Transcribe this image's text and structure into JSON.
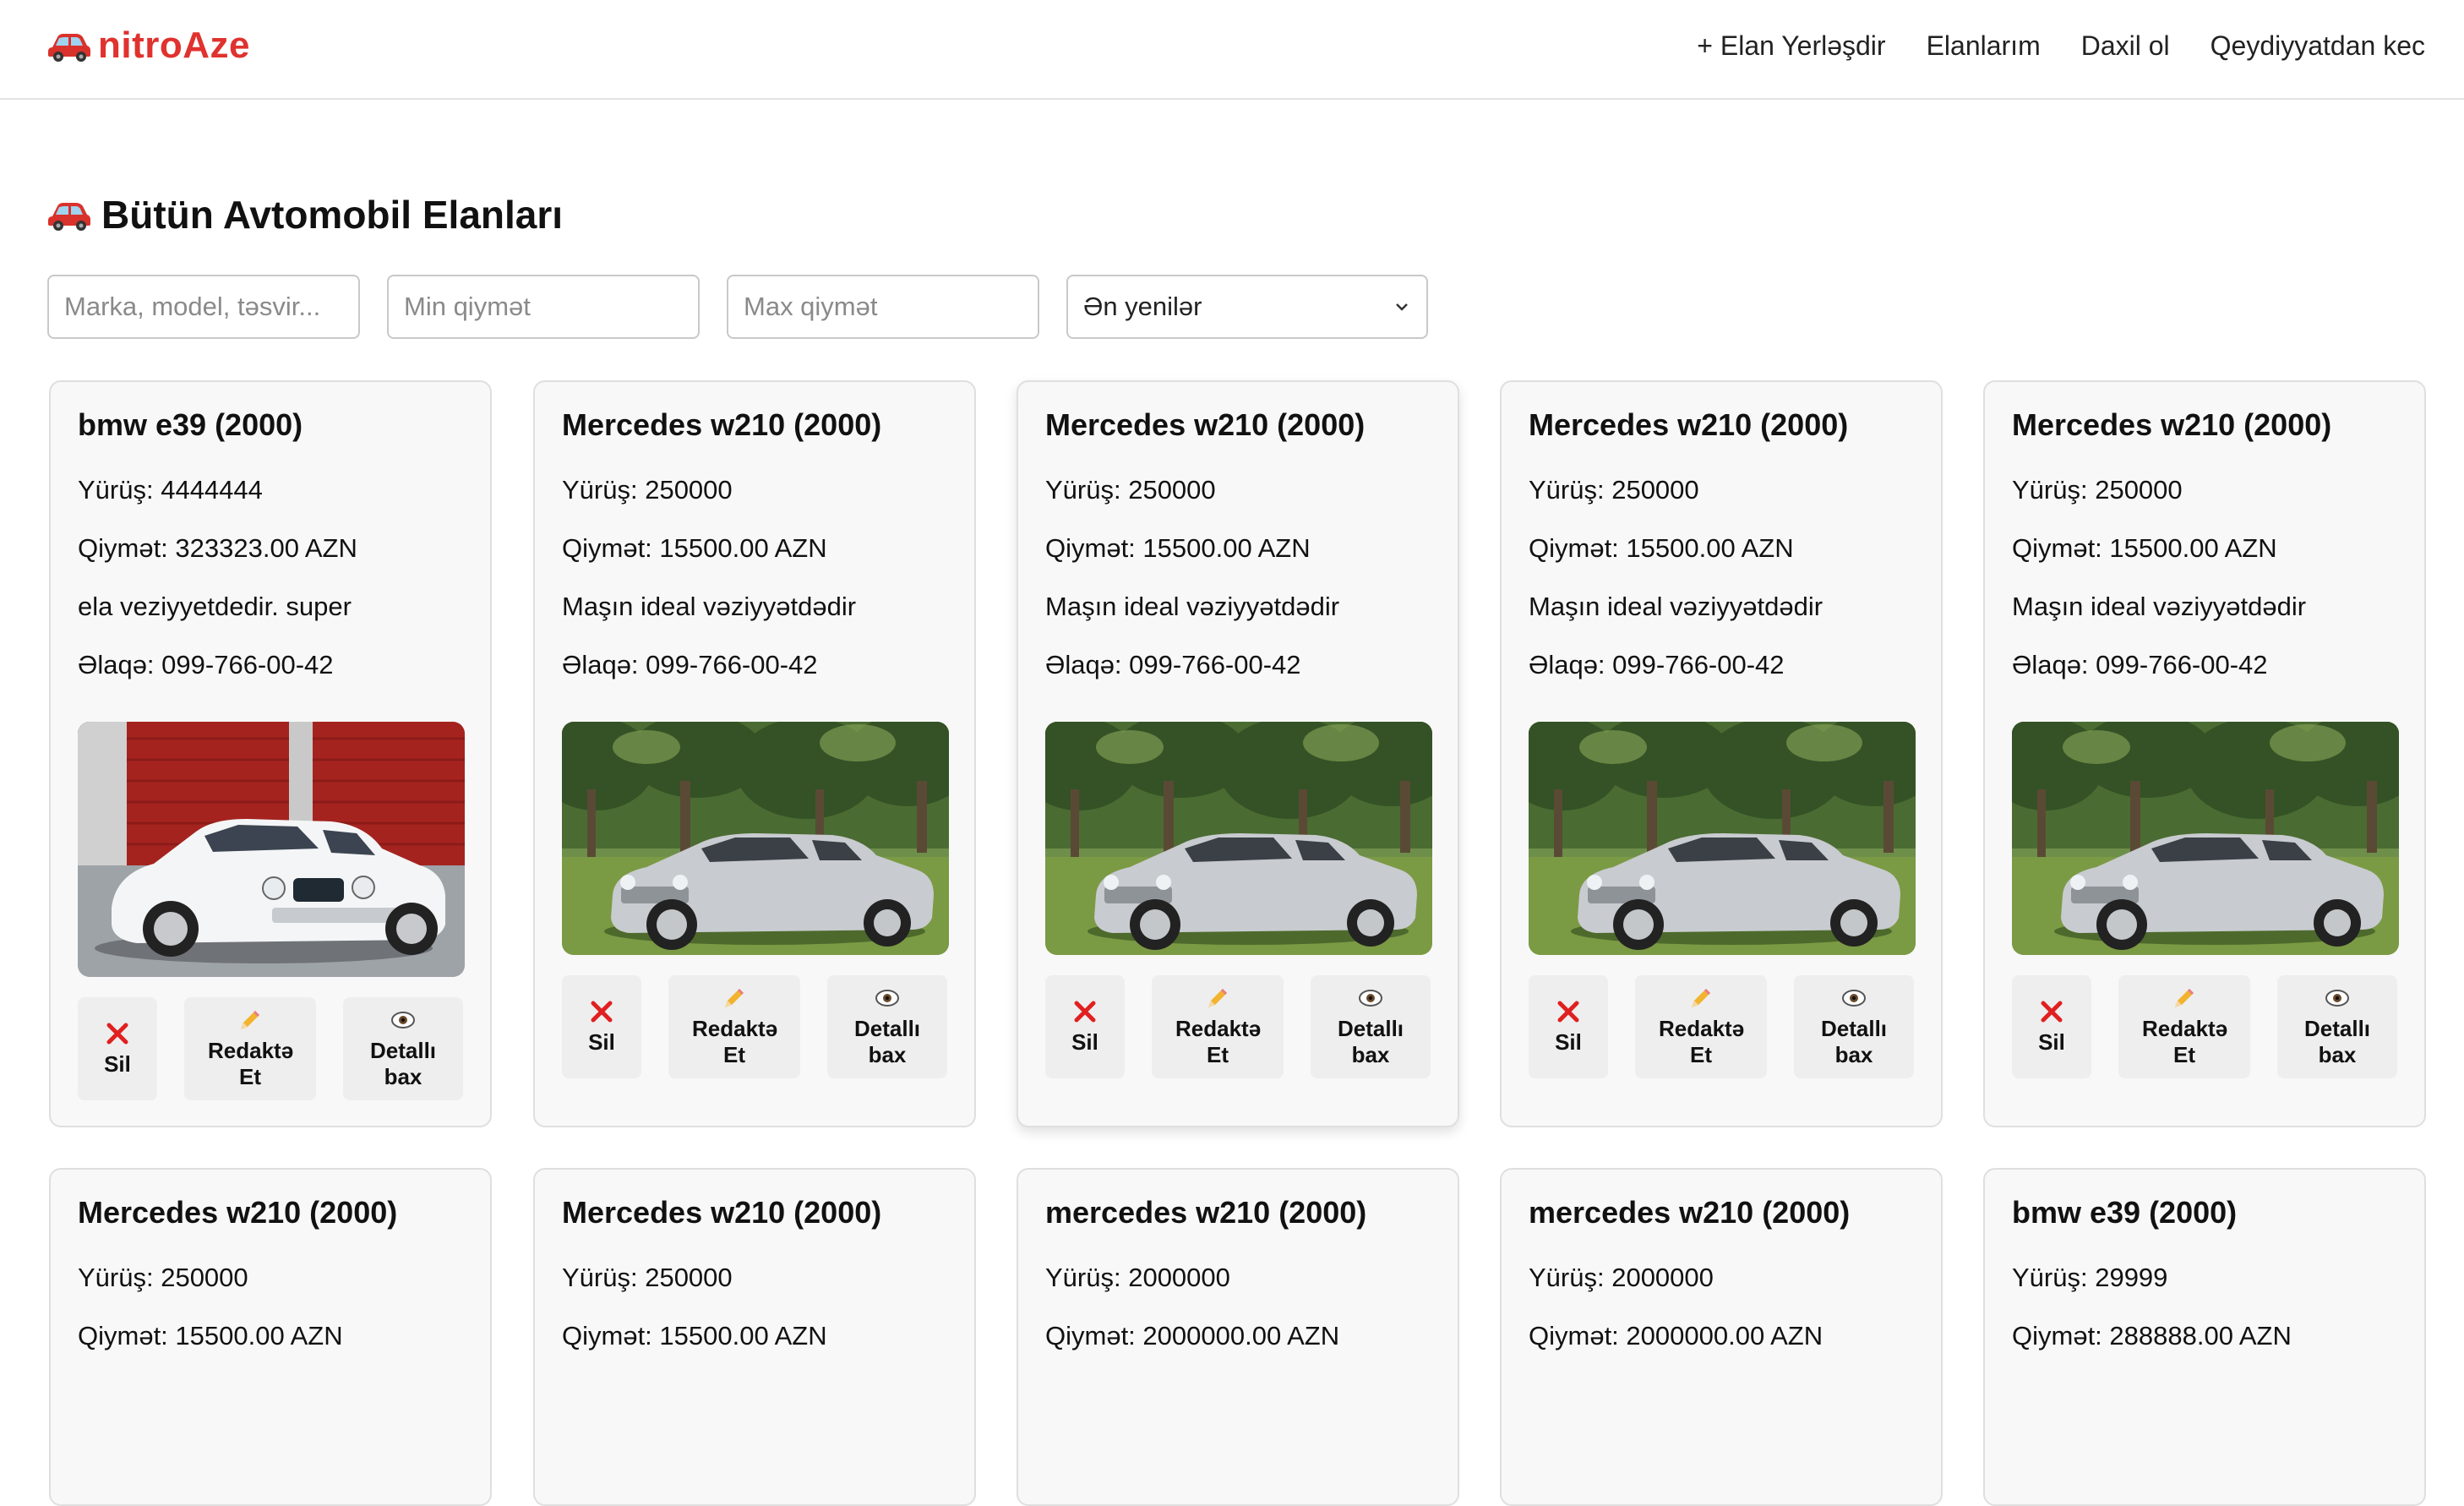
{
  "header": {
    "logo": "nitroAze",
    "nav": [
      "+ Elan Yerləşdir",
      "Elanlarım",
      "Daxil ol",
      "Qeydiyyatdan kec"
    ]
  },
  "page_title": "Bütün Avtomobil Elanları",
  "filters": {
    "search_placeholder": "Marka, model, təsvir...",
    "min_placeholder": "Min qiymət",
    "max_placeholder": "Max qiymət",
    "sort_selected": "Ən yenilər"
  },
  "actions": {
    "delete": "Sil",
    "edit": "Redaktə Et",
    "details": "Detallı bax"
  },
  "cards": [
    {
      "title": "bmw e39 (2000)",
      "mileage": "Yürüş: 4444444",
      "price": "Qiymət: 323323.00 AZN",
      "desc": "ela veziyyetdedir. super",
      "contact": "Əlaqə: 099-766-00-42",
      "image": "white-bmw"
    },
    {
      "title": "Mercedes w210 (2000)",
      "mileage": "Yürüş: 250000",
      "price": "Qiymət: 15500.00 AZN",
      "desc": "Maşın ideal vəziyyətdədir",
      "contact": "Əlaqə: 099-766-00-42",
      "image": "silver-mercedes"
    },
    {
      "title": "Mercedes w210 (2000)",
      "mileage": "Yürüş: 250000",
      "price": "Qiymət: 15500.00 AZN",
      "desc": "Maşın ideal vəziyyətdədir",
      "contact": "Əlaqə: 099-766-00-42",
      "image": "silver-mercedes"
    },
    {
      "title": "Mercedes w210 (2000)",
      "mileage": "Yürüş: 250000",
      "price": "Qiymət: 15500.00 AZN",
      "desc": "Maşın ideal vəziyyətdədir",
      "contact": "Əlaqə: 099-766-00-42",
      "image": "silver-mercedes"
    },
    {
      "title": "Mercedes w210 (2000)",
      "mileage": "Yürüş: 250000",
      "price": "Qiymət: 15500.00 AZN",
      "desc": "Maşın ideal vəziyyətdədir",
      "contact": "Əlaqə: 099-766-00-42",
      "image": "silver-mercedes"
    },
    {
      "title": "Mercedes w210 (2000)",
      "mileage": "Yürüş: 250000",
      "price": "Qiymət: 15500.00 AZN",
      "desc": "",
      "contact": "",
      "image": ""
    },
    {
      "title": "Mercedes w210 (2000)",
      "mileage": "Yürüş: 250000",
      "price": "Qiymət: 15500.00 AZN",
      "desc": "",
      "contact": "",
      "image": ""
    },
    {
      "title": "mercedes w210 (2000)",
      "mileage": "Yürüş: 2000000",
      "price": "Qiymət: 2000000.00 AZN",
      "desc": "",
      "contact": "",
      "image": ""
    },
    {
      "title": "mercedes w210 (2000)",
      "mileage": "Yürüş: 2000000",
      "price": "Qiymət: 2000000.00 AZN",
      "desc": "",
      "contact": "",
      "image": ""
    },
    {
      "title": "bmw e39 (2000)",
      "mileage": "Yürüş: 29999",
      "price": "Qiymət: 288888.00 AZN",
      "desc": "",
      "contact": "",
      "image": ""
    }
  ]
}
